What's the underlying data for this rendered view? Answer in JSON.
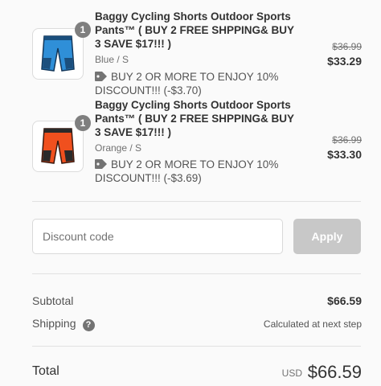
{
  "items": [
    {
      "quantity": "1",
      "title": "Baggy Cycling Shorts Outdoor Sports Pants™ ( BUY 2 FREE SHPPING& BUY 3 SAVE $17!!! )",
      "variant": "Blue / S",
      "discount": "BUY 2 OR MORE TO ENJOY 10% DISCOUNT!!! (-$3.70)",
      "original_price": "$36.99",
      "price": "$33.29",
      "color": "#2f8fd8"
    },
    {
      "quantity": "1",
      "title": "Baggy Cycling Shorts Outdoor Sports Pants™ ( BUY 2 FREE SHPPING& BUY 3 SAVE $17!!! )",
      "variant": "Orange / S",
      "discount": "BUY 2 OR MORE TO ENJOY 10% DISCOUNT!!! (-$3.69)",
      "original_price": "$36.99",
      "price": "$33.30",
      "color": "#f0501e"
    }
  ],
  "discount": {
    "placeholder": "Discount code",
    "apply_label": "Apply"
  },
  "summary": {
    "subtotal_label": "Subtotal",
    "subtotal_value": "$66.59",
    "shipping_label": "Shipping",
    "shipping_value": "Calculated at next step",
    "help_icon": "question-circle-icon"
  },
  "total": {
    "label": "Total",
    "currency": "USD",
    "value": "$66.59"
  }
}
